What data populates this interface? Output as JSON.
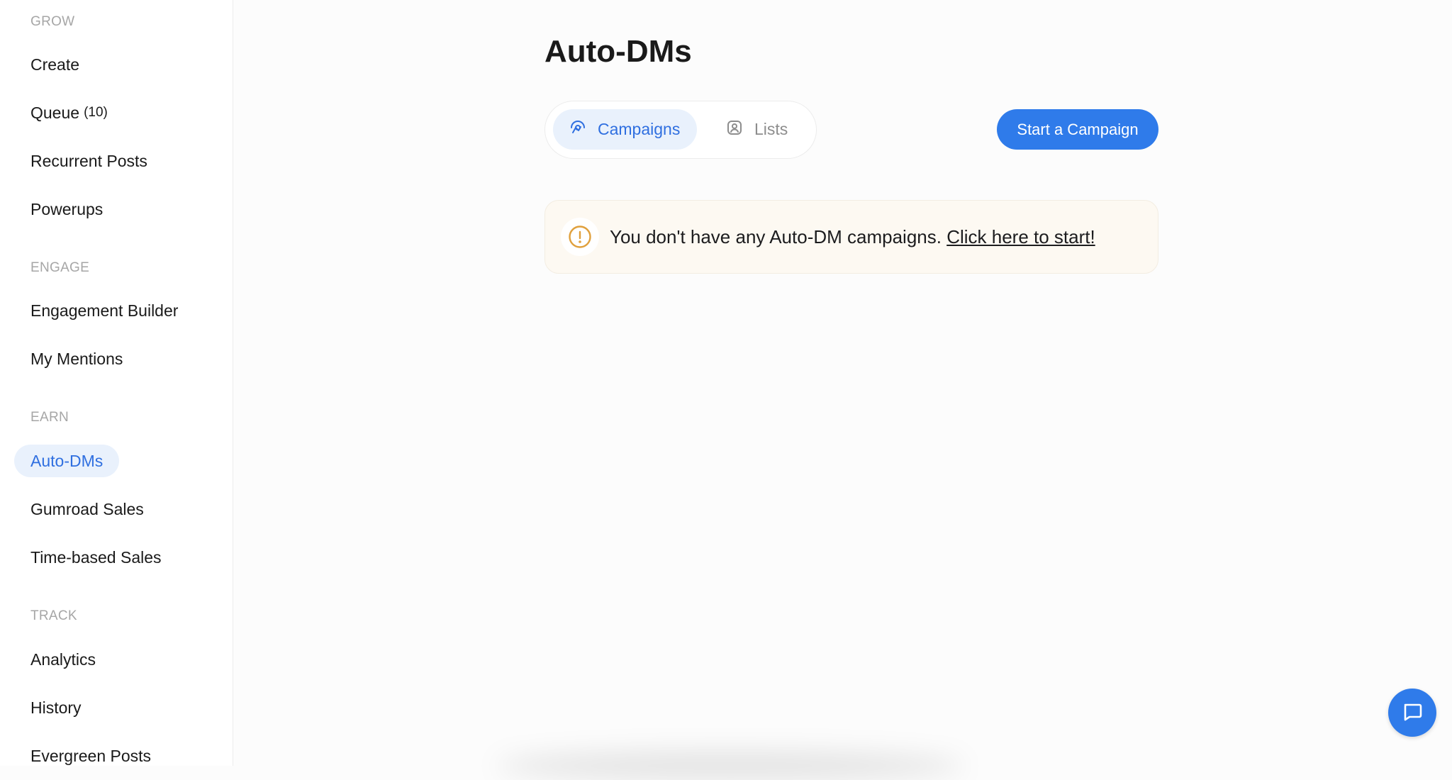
{
  "sidebar": {
    "sections": [
      {
        "title": "GROW",
        "items": [
          {
            "label": "Create",
            "count": ""
          },
          {
            "label": "Queue",
            "count": "(10)"
          },
          {
            "label": "Recurrent Posts",
            "count": ""
          },
          {
            "label": "Powerups",
            "count": ""
          }
        ]
      },
      {
        "title": "ENGAGE",
        "items": [
          {
            "label": "Engagement Builder",
            "count": ""
          },
          {
            "label": "My Mentions",
            "count": ""
          }
        ]
      },
      {
        "title": "EARN",
        "items": [
          {
            "label": "Auto-DMs",
            "count": "",
            "active": true
          },
          {
            "label": "Gumroad Sales",
            "count": ""
          },
          {
            "label": "Time-based Sales",
            "count": ""
          }
        ]
      },
      {
        "title": "TRACK",
        "items": [
          {
            "label": "Analytics",
            "count": ""
          },
          {
            "label": "History",
            "count": ""
          },
          {
            "label": "Evergreen Posts",
            "count": ""
          }
        ]
      }
    ]
  },
  "main": {
    "title": "Auto-DMs",
    "tabs": [
      {
        "label": "Campaigns",
        "icon": "campaign-icon",
        "active": true
      },
      {
        "label": "Lists",
        "icon": "user-list-icon",
        "active": false
      }
    ],
    "start_button": "Start a Campaign",
    "notice": {
      "icon": "alert-circle-icon",
      "text": "You don't have any Auto-DM campaigns. ",
      "link": "Click here to start!"
    }
  },
  "chat": {
    "icon": "chat-bubble-icon"
  },
  "colors": {
    "accent": "#2f7bea",
    "active_bg": "#e9f1fc",
    "notice_bg": "#fdf9f2",
    "warning": "#e0a03c"
  }
}
